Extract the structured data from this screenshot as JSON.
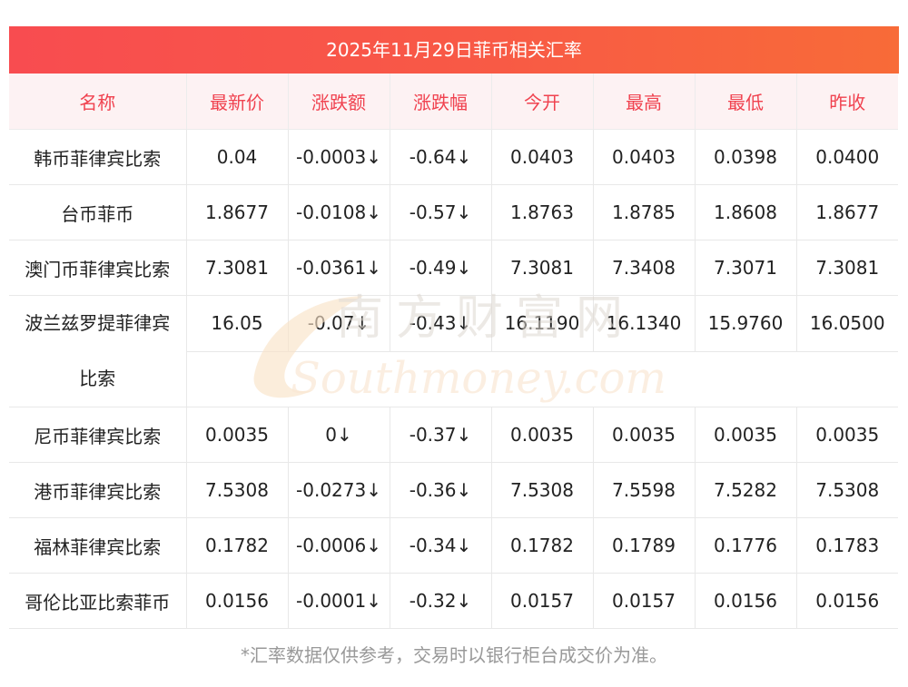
{
  "title": "2025年11月29日菲币相关汇率",
  "columns": [
    "名称",
    "最新价",
    "涨跌额",
    "涨跌幅",
    "今开",
    "最高",
    "最低",
    "昨收"
  ],
  "rows": [
    {
      "name": "韩币菲律宾比索",
      "latest": "0.04",
      "change": "-0.0003",
      "change_pct": "-0.64",
      "open": "0.0403",
      "high": "0.0403",
      "low": "0.0398",
      "prev_close": "0.0400"
    },
    {
      "name": "台币菲币",
      "latest": "1.8677",
      "change": "-0.0108",
      "change_pct": "-0.57",
      "open": "1.8763",
      "high": "1.8785",
      "low": "1.8608",
      "prev_close": "1.8677"
    },
    {
      "name": "澳门币菲律宾比索",
      "latest": "7.3081",
      "change": "-0.0361",
      "change_pct": "-0.49",
      "open": "7.3081",
      "high": "7.3408",
      "low": "7.3071",
      "prev_close": "7.3081"
    },
    {
      "name_line1": "波兰兹罗提菲律宾",
      "name_line2": "比索",
      "latest": "16.05",
      "change": "-0.07",
      "change_pct": "-0.43",
      "open": "16.1190",
      "high": "16.1340",
      "low": "15.9760",
      "prev_close": "16.0500"
    },
    {
      "name": "尼币菲律宾比索",
      "latest": "0.0035",
      "change": "0",
      "change_pct": "-0.37",
      "open": "0.0035",
      "high": "0.0035",
      "low": "0.0035",
      "prev_close": "0.0035"
    },
    {
      "name": "港币菲律宾比索",
      "latest": "7.5308",
      "change": "-0.0273",
      "change_pct": "-0.36",
      "open": "7.5308",
      "high": "7.5598",
      "low": "7.5282",
      "prev_close": "7.5308"
    },
    {
      "name": "福林菲律宾比索",
      "latest": "0.1782",
      "change": "-0.0006",
      "change_pct": "-0.34",
      "open": "0.1782",
      "high": "0.1789",
      "low": "0.1776",
      "prev_close": "0.1783"
    },
    {
      "name": "哥伦比亚比索菲币",
      "latest": "0.0156",
      "change": "-0.0001",
      "change_pct": "-0.32",
      "open": "0.0157",
      "high": "0.0157",
      "low": "0.0156",
      "prev_close": "0.0156"
    }
  ],
  "down_arrow": "↓",
  "footer_note": "*汇率数据仅供参考，交易时以银行柜台成交价为准。",
  "watermark": {
    "line1": "南方财富网",
    "line2": "Southmoney.com"
  },
  "colors": {
    "title_bar": "#f85a45",
    "header_text": "#f0424f",
    "header_bg": "#fdf2f3",
    "down": "#1a9a1a"
  }
}
